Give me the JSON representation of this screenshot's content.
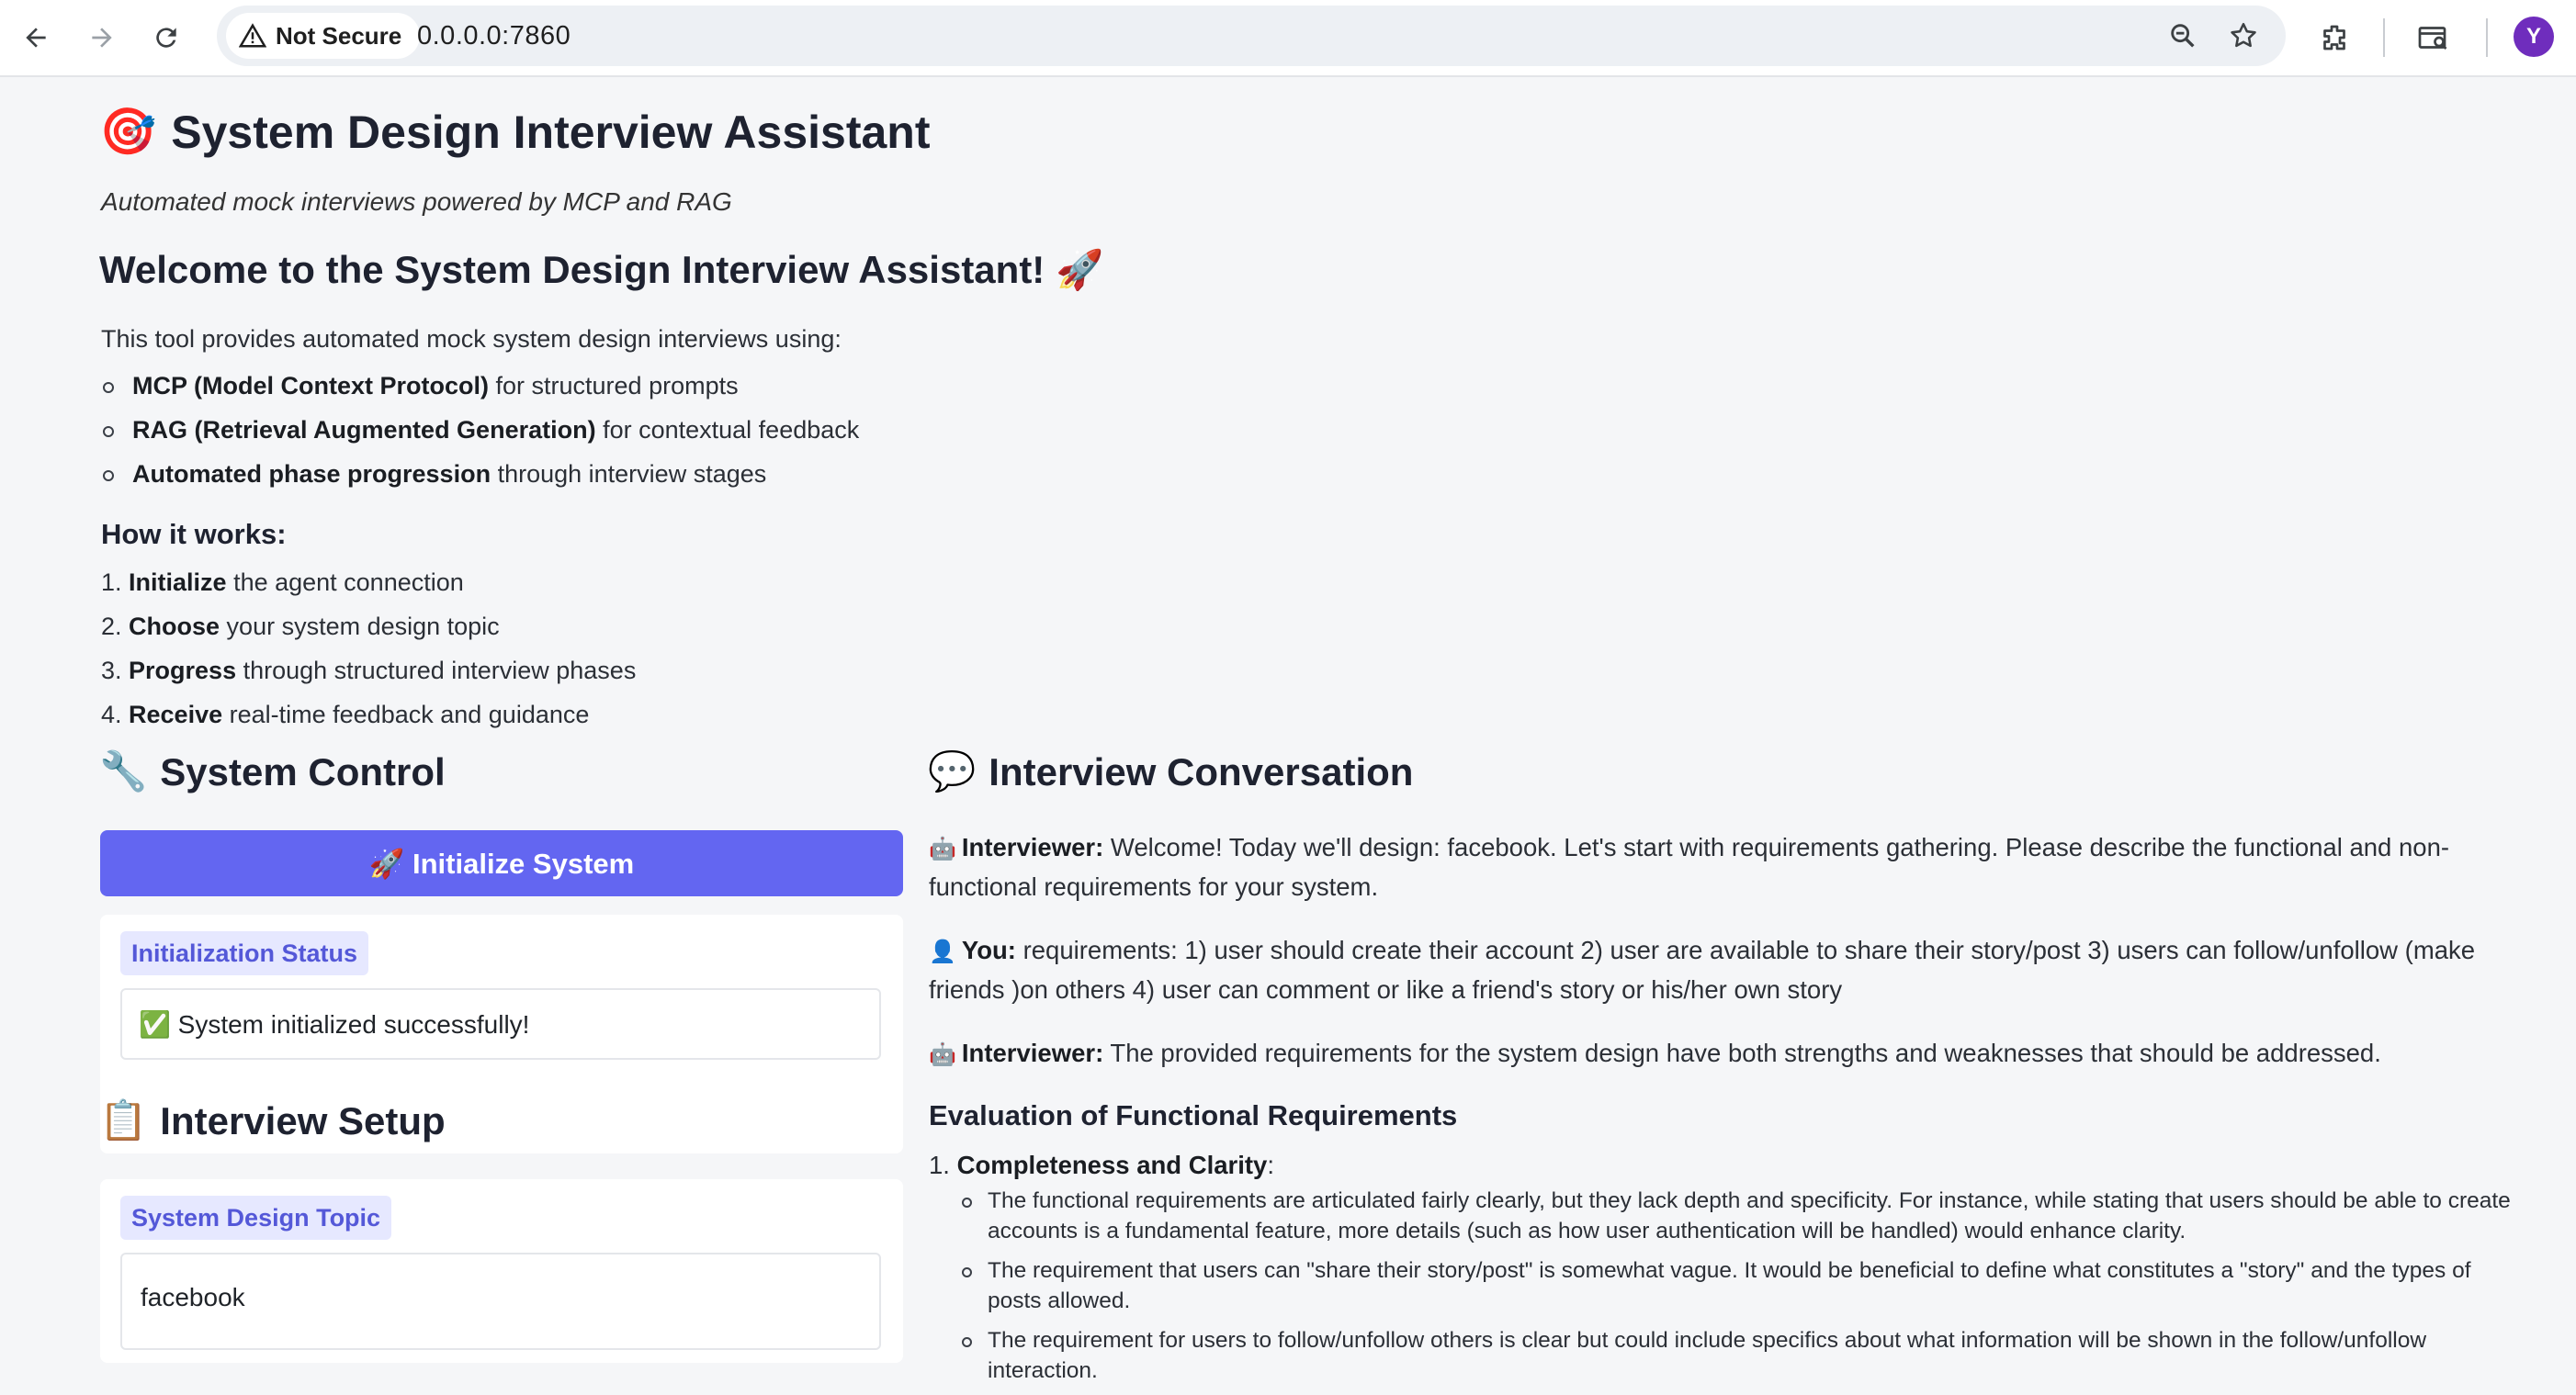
{
  "browser": {
    "security_label": "Not Secure",
    "url": "0.0.0.0:7860",
    "profile_initial": "Y"
  },
  "header": {
    "title_emoji": "🎯",
    "title": "System Design Interview Assistant",
    "subtitle": "Automated mock interviews powered by MCP and RAG"
  },
  "welcome": {
    "heading": "Welcome to the System Design Interview Assistant! 🚀",
    "intro": "This tool provides automated mock system design interviews using:",
    "features": [
      {
        "bold": "MCP (Model Context Protocol)",
        "text": " for structured prompts"
      },
      {
        "bold": "RAG (Retrieval Augmented Generation)",
        "text": " for contextual feedback"
      },
      {
        "bold": "Automated phase progression",
        "text": " through interview stages"
      }
    ],
    "how_title": "How it works:",
    "steps": [
      {
        "num": "1. ",
        "bold": "Initialize",
        "text": " the agent connection"
      },
      {
        "num": "2. ",
        "bold": "Choose",
        "text": " your system design topic"
      },
      {
        "num": "3. ",
        "bold": "Progress",
        "text": " through structured interview phases"
      },
      {
        "num": "4. ",
        "bold": "Receive",
        "text": " real-time feedback and guidance"
      }
    ]
  },
  "system_control": {
    "emoji": "🔧",
    "heading": "System Control",
    "init_button": "🚀 Initialize System",
    "status_label": "Initialization Status",
    "status_value": "✅ System initialized successfully!"
  },
  "interview_setup": {
    "emoji": "📋",
    "heading": "Interview Setup",
    "topic_label": "System Design Topic",
    "topic_value": "facebook"
  },
  "conversation": {
    "emoji": "💬",
    "heading": "Interview Conversation",
    "messages": [
      {
        "emoji": "🤖",
        "speaker": "Interviewer:",
        "text": " Welcome! Today we'll design: facebook. Let's start with requirements gathering. Please describe the functional and non-functional requirements for your system."
      },
      {
        "emoji": "👤",
        "speaker": "You:",
        "text": " requirements: 1) user should create their account 2) user are available to share their story/post 3) users can follow/unfollow (make friends )on others 4) user can comment or like a friend's story or his/her own story"
      },
      {
        "emoji": "🤖",
        "speaker": "Interviewer:",
        "text": " The provided requirements for the system design have both strengths and weaknesses that should be addressed."
      }
    ],
    "eval_heading": "Evaluation of Functional Requirements",
    "eval_item": {
      "num": "1. ",
      "bold": "Completeness and Clarity",
      "text": ":"
    },
    "eval_bullets": [
      "The functional requirements are articulated fairly clearly, but they lack depth and specificity. For instance, while stating that users should be able to create accounts is a fundamental feature, more details (such as how user authentication will be handled) would enhance clarity.",
      "The requirement that users can \"share their story/post\" is somewhat vague. It would be beneficial to define what constitutes a \"story\" and the types of posts allowed.",
      "The requirement for users to follow/unfollow others is clear but could include specifics about what information will be shown in the follow/unfollow interaction."
    ]
  },
  "colors": {
    "accent": "#6366f1",
    "label_bg": "#e6e8ff",
    "label_text": "#5458d8",
    "page_bg": "#f5f6f8"
  }
}
